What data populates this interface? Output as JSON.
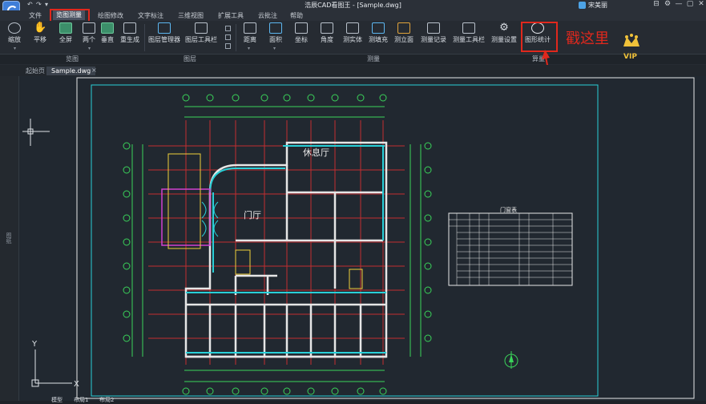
{
  "titlebar": {
    "quick_icons": [
      "undo-icon",
      "redo-icon",
      "dropdown-icon"
    ],
    "title": "浩辰CAD看图王 - [Sample.dwg]",
    "user": "宋美丽",
    "window_buttons": [
      "⊟",
      "⚙",
      "—",
      "▢",
      "✕"
    ]
  },
  "menu": {
    "items": [
      "文件",
      "览图测量",
      "绘图修改",
      "文字标注",
      "三维视图",
      "扩展工具",
      "云批注",
      "帮助"
    ],
    "active": "览图测量"
  },
  "ribbon": {
    "browse": {
      "label": "览图",
      "buttons": [
        "缩放",
        "平移",
        "全屏",
        "两个",
        "垂直",
        "重生成"
      ]
    },
    "layers": {
      "label": "图层",
      "buttons": [
        "图层管理器",
        "图层工具栏"
      ]
    },
    "measure": {
      "label": "测量",
      "buttons": [
        "距离",
        "面积",
        "坐标",
        "角度",
        "测实体",
        "测填充",
        "测立面",
        "测量记录",
        "测量工具栏",
        "测量设置"
      ]
    },
    "calc": {
      "label": "算量",
      "buttons": [
        "图形统计"
      ]
    }
  },
  "annotation": {
    "text": "戳这里"
  },
  "vip": {
    "label": "VIP"
  },
  "tabs": {
    "items": [
      "起始页",
      "Sample.dwg"
    ],
    "active": "Sample.dwg",
    "close": "×"
  },
  "sidebar": {
    "label": "图纸"
  },
  "drawing": {
    "room_rest": "休息厅",
    "room_lobby": "门厅",
    "table_title": "门窗表",
    "axis_y": "Y",
    "axis_x": "X"
  },
  "layout_tabs": {
    "items": [
      "模型",
      "布局1",
      "布局2"
    ]
  },
  "colors": {
    "accent": "#e0281d",
    "canvas": "#212830",
    "cad_wall": "#29d0d8",
    "cad_grid": "#e03030",
    "cad_green": "#3ad35a"
  }
}
